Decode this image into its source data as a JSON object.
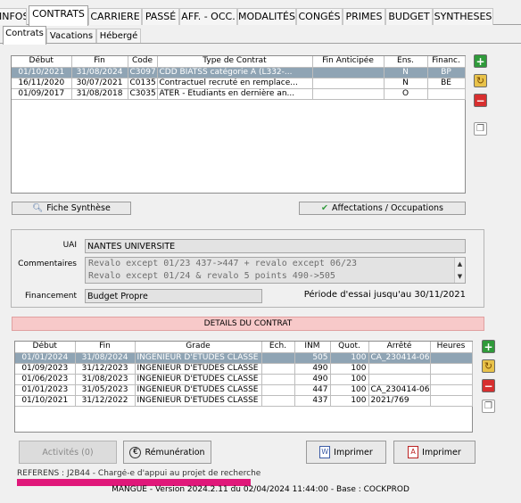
{
  "top_tabs": [
    "INFOS",
    "CONTRATS",
    "CARRIERE",
    "PASSÉ",
    "AFF. - OCC.",
    "MODALITÉS",
    "CONGÉS",
    "PRIMES",
    "BUDGET",
    "SYNTHESES"
  ],
  "sub_tabs": [
    "Contrats",
    "Vacations",
    "Hébergé"
  ],
  "contracts": {
    "headers": [
      "Début",
      "Fin",
      "Code",
      "Type de Contrat",
      "Fin Anticipée",
      "Ens.",
      "Financ."
    ],
    "rows": [
      {
        "debut": "01/10/2021",
        "fin": "31/08/2024",
        "code": "C3097",
        "type": "CDD BIATSS catégorie A (L332-...",
        "fin_anticipee": "",
        "ens": "N",
        "financ": "BP"
      },
      {
        "debut": "16/11/2020",
        "fin": "30/07/2021",
        "code": "C0135",
        "type": "Contractuel recruté en remplace...",
        "fin_anticipee": "",
        "ens": "N",
        "financ": "BE"
      },
      {
        "debut": "01/09/2017",
        "fin": "31/08/2018",
        "code": "C3035",
        "type": "ATER - Etudiants en dernière an...",
        "fin_anticipee": "",
        "ens": "O",
        "financ": ""
      }
    ]
  },
  "buttons": {
    "fiche_synthese": "Fiche Synthèse",
    "affectations": "Affectations / Occupations",
    "activites": "Activités (0)",
    "remuneration": "Rémunération",
    "imprimer1": "Imprimer",
    "imprimer2": "Imprimer"
  },
  "details_form": {
    "uai_label": "UAI",
    "uai_value": "NANTES UNIVERSITE",
    "commentaires_label": "Commentaires",
    "commentaires_line1": "Revalo except 01/23 437->447 + revalo except 06/23",
    "commentaires_line2": "Revalo except 01/24 & revalo 5 points 490->505",
    "financement_label": "Financement",
    "financement_value": "Budget Propre",
    "periode_essai": "Période d'essai jusqu'au 30/11/2021"
  },
  "details_header": "DETAILS DU CONTRAT",
  "details": {
    "headers": [
      "Début",
      "Fin",
      "Grade",
      "Ech.",
      "INM",
      "Quot.",
      "Arrêté",
      "Heures"
    ],
    "rows": [
      {
        "debut": "01/01/2024",
        "fin": "31/08/2024",
        "grade": "INGENIEUR D'ETUDES CLASSE ...",
        "ech": "",
        "inm": "505",
        "quot": "100",
        "arrete": "CA_230414-06",
        "heures": ""
      },
      {
        "debut": "01/09/2023",
        "fin": "31/12/2023",
        "grade": "INGENIEUR D'ETUDES CLASSE ...",
        "ech": "",
        "inm": "490",
        "quot": "100",
        "arrete": "",
        "heures": ""
      },
      {
        "debut": "01/06/2023",
        "fin": "31/08/2023",
        "grade": "INGENIEUR D'ETUDES CLASSE ...",
        "ech": "",
        "inm": "490",
        "quot": "100",
        "arrete": "",
        "heures": ""
      },
      {
        "debut": "01/01/2023",
        "fin": "31/05/2023",
        "grade": "INGENIEUR D'ETUDES CLASSE ...",
        "ech": "",
        "inm": "447",
        "quot": "100",
        "arrete": "CA_230414-06",
        "heures": ""
      },
      {
        "debut": "01/10/2021",
        "fin": "31/12/2022",
        "grade": "INGENIEUR D'ETUDES CLASSE ...",
        "ech": "",
        "inm": "437",
        "quot": "100",
        "arrete": "2021/769",
        "heures": ""
      }
    ]
  },
  "status_line": "REFERENS : J2B44 - Chargé-e d'appui au projet de recherche",
  "footer": "MANGUE  - Version 2024.2.11 du 02/04/2024 11:44:00 - Base : COCKPROD",
  "colors": {
    "selection": "#8fa4b4",
    "details_band": "#f7c9c9",
    "progress": "#e0187a"
  }
}
